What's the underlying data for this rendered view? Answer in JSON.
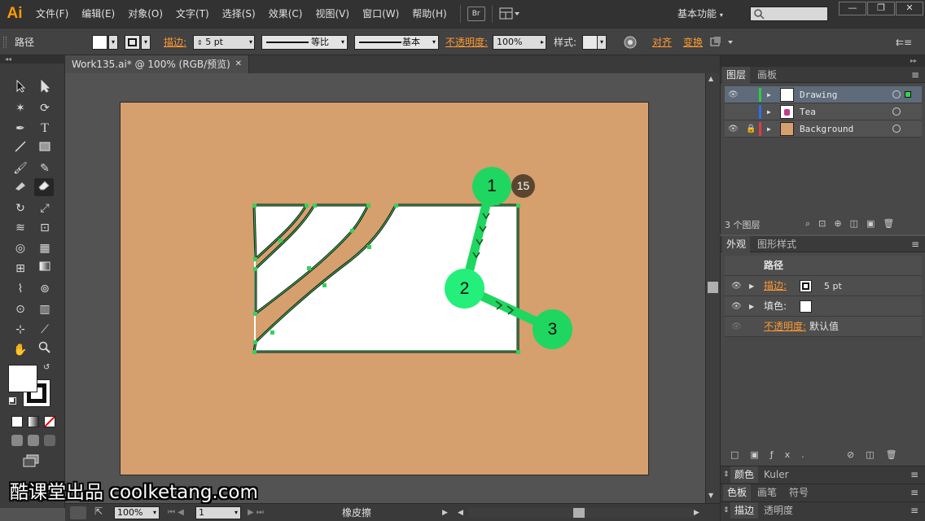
{
  "menubar": {
    "logo": "Ai",
    "items": [
      "文件(F)",
      "编辑(E)",
      "对象(O)",
      "文字(T)",
      "选择(S)",
      "效果(C)",
      "视图(V)",
      "窗口(W)",
      "帮助(H)"
    ],
    "bridge_label": "Br",
    "workspace": "基本功能",
    "window_buttons": [
      "—",
      "❐",
      "✕"
    ]
  },
  "controlbar": {
    "object_type": "路径",
    "stroke_label": "描边:",
    "stroke_weight": "5 pt",
    "profile_label": "等比",
    "brush_label": "基本",
    "opacity_label": "不透明度:",
    "opacity_value": "100%",
    "style_label": "样式:",
    "align_label": "对齐",
    "transform_label": "变换"
  },
  "document": {
    "tab_title": "Work135.ai* @ 100% (RGB/预览)",
    "tab_close": "✕"
  },
  "statusbar": {
    "zoom": "100%",
    "artboard_number": "1",
    "current_tool": "橡皮擦"
  },
  "layers_panel": {
    "tabs": [
      "图层",
      "画板"
    ],
    "layers": [
      {
        "name": "Drawing",
        "color": "#2ecc40",
        "selected": true
      },
      {
        "name": "Tea",
        "color": "#2f6fe8",
        "selected": false
      },
      {
        "name": "Background",
        "color": "#e03c3c",
        "selected": false
      }
    ],
    "count_label": "3 个图层"
  },
  "appearance_panel": {
    "tabs": [
      "外观",
      "图形样式"
    ],
    "header": "路径",
    "stroke_label": "描边:",
    "stroke_value": "5 pt",
    "fill_label": "填色:",
    "opacity_label": "不透明度:",
    "opacity_value": "默认值"
  },
  "collapsed_panels": {
    "row1": [
      "颜色",
      "Kuler"
    ],
    "row2": [
      "色板",
      "画笔",
      "符号"
    ],
    "row3": [
      "描边",
      "透明度"
    ]
  },
  "annotations": {
    "step_badge": "15",
    "markers": [
      "1",
      "2",
      "3"
    ]
  },
  "watermark": "酷课堂出品 coolketang.com",
  "colors": {
    "artboard": "#d69f6e",
    "marker_green": "#1fd660",
    "accent_orange": "#ff9a30"
  }
}
